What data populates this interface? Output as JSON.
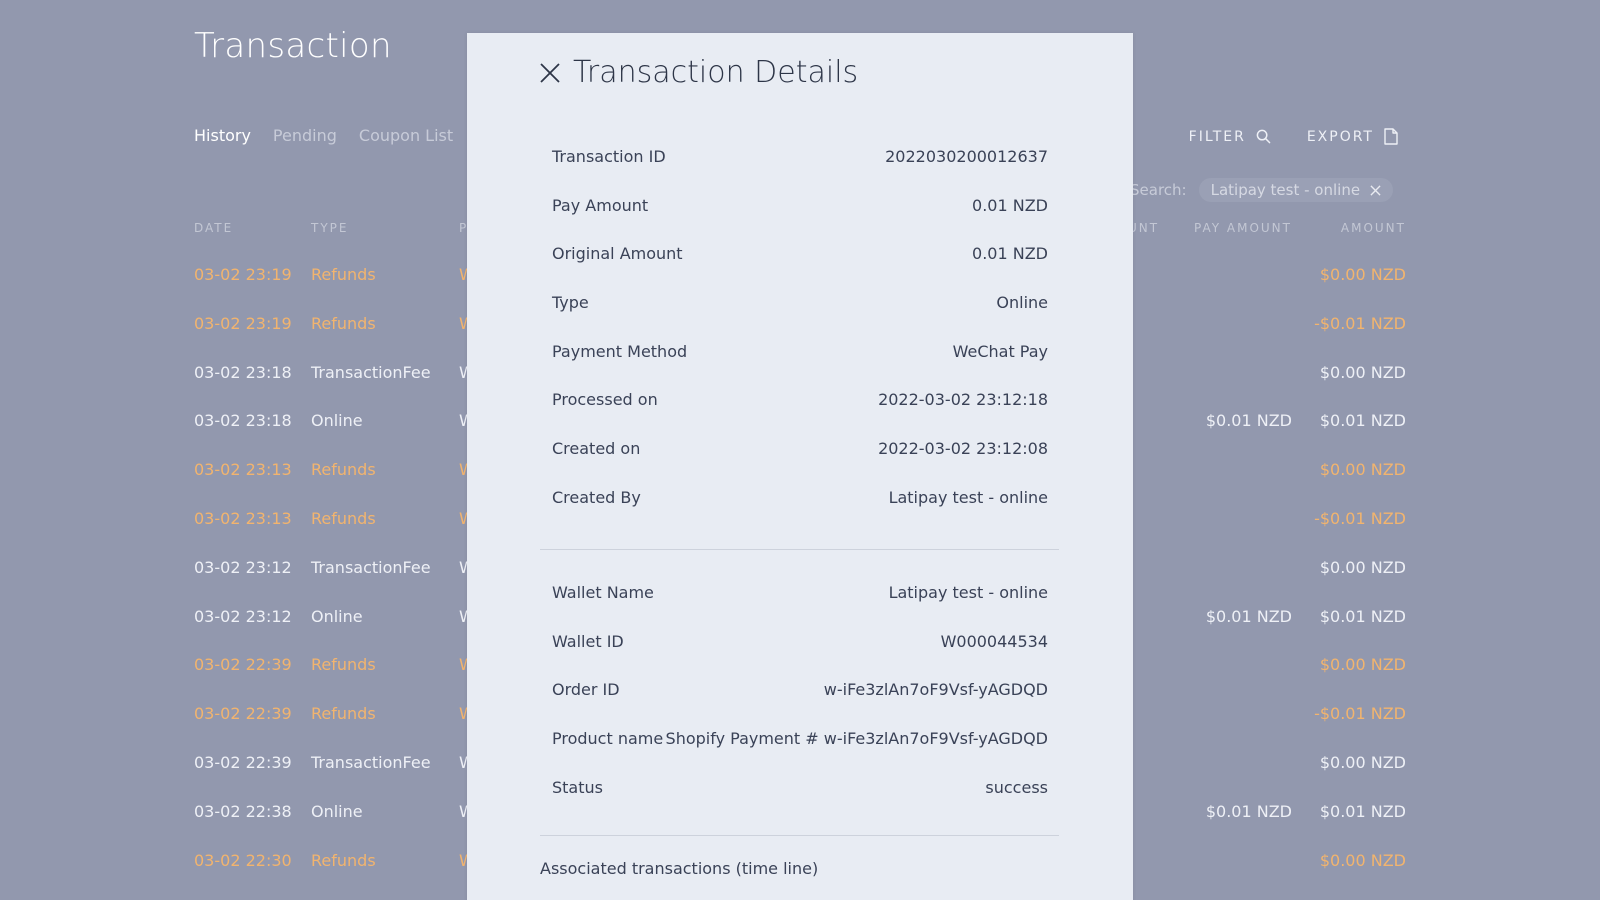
{
  "page": {
    "title": "Transaction",
    "tabs": [
      "History",
      "Pending",
      "Coupon List"
    ],
    "active_tab": "History",
    "filter_label": "FILTER",
    "export_label": "EXPORT",
    "search_label": "Search:",
    "search_chip": "Latipay test - online"
  },
  "table": {
    "headers": {
      "date": "DATE",
      "type": "TYPE",
      "p": "P",
      "unt": "UNT",
      "pay_amount": "PAY AMOUNT",
      "amount": "AMOUNT"
    },
    "rows": [
      {
        "date": "03-02 23:19",
        "type": "Refunds",
        "p": "W",
        "pay": "",
        "amount": "$0.00 NZD",
        "refund": true
      },
      {
        "date": "03-02 23:19",
        "type": "Refunds",
        "p": "W",
        "pay": "",
        "amount": "-$0.01 NZD",
        "refund": true
      },
      {
        "date": "03-02 23:18",
        "type": "TransactionFee",
        "p": "W",
        "pay": "",
        "amount": "$0.00 NZD",
        "refund": false
      },
      {
        "date": "03-02 23:18",
        "type": "Online",
        "p": "W",
        "pay": "$0.01 NZD",
        "amount": "$0.01 NZD",
        "refund": false
      },
      {
        "date": "03-02 23:13",
        "type": "Refunds",
        "p": "W",
        "pay": "",
        "amount": "$0.00 NZD",
        "refund": true
      },
      {
        "date": "03-02 23:13",
        "type": "Refunds",
        "p": "W",
        "pay": "",
        "amount": "-$0.01 NZD",
        "refund": true
      },
      {
        "date": "03-02 23:12",
        "type": "TransactionFee",
        "p": "W",
        "pay": "",
        "amount": "$0.00 NZD",
        "refund": false
      },
      {
        "date": "03-02 23:12",
        "type": "Online",
        "p": "W",
        "pay": "$0.01 NZD",
        "amount": "$0.01 NZD",
        "refund": false
      },
      {
        "date": "03-02 22:39",
        "type": "Refunds",
        "p": "W",
        "pay": "",
        "amount": "$0.00 NZD",
        "refund": true
      },
      {
        "date": "03-02 22:39",
        "type": "Refunds",
        "p": "W",
        "pay": "",
        "amount": "-$0.01 NZD",
        "refund": true
      },
      {
        "date": "03-02 22:39",
        "type": "TransactionFee",
        "p": "W",
        "pay": "",
        "amount": "$0.00 NZD",
        "refund": false
      },
      {
        "date": "03-02 22:38",
        "type": "Online",
        "p": "W",
        "pay": "$0.01 NZD",
        "amount": "$0.01 NZD",
        "refund": false
      },
      {
        "date": "03-02 22:30",
        "type": "Refunds",
        "p": "W",
        "pay": "",
        "amount": "$0.00 NZD",
        "refund": true
      }
    ]
  },
  "modal": {
    "title": "Transaction Details",
    "details_a": [
      {
        "label": "Transaction ID",
        "value": "2022030200012637"
      },
      {
        "label": "Pay Amount",
        "value": "0.01 NZD"
      },
      {
        "label": "Original Amount",
        "value": "0.01 NZD"
      },
      {
        "label": "Type",
        "value": "Online"
      },
      {
        "label": "Payment Method",
        "value": "WeChat Pay"
      },
      {
        "label": "Processed on",
        "value": "2022-03-02 23:12:18"
      },
      {
        "label": "Created on",
        "value": "2022-03-02 23:12:08"
      },
      {
        "label": "Created By",
        "value": "Latipay test - online"
      }
    ],
    "details_b": [
      {
        "label": "Wallet Name",
        "value": "Latipay test - online"
      },
      {
        "label": "Wallet ID",
        "value": "W000044534"
      },
      {
        "label": "Order ID",
        "value": "w-iFe3zlAn7oF9Vsf-yAGDQD"
      },
      {
        "label": "Product name",
        "value": "Shopify Payment # w-iFe3zlAn7oF9Vsf-yAGDQD"
      },
      {
        "label": "Status",
        "value": "success"
      }
    ],
    "associated_label": "Associated transactions (time line)"
  },
  "colors": {
    "background": "#9298ae",
    "modal": "#e8ecf3",
    "refund": "#f2b46e"
  }
}
